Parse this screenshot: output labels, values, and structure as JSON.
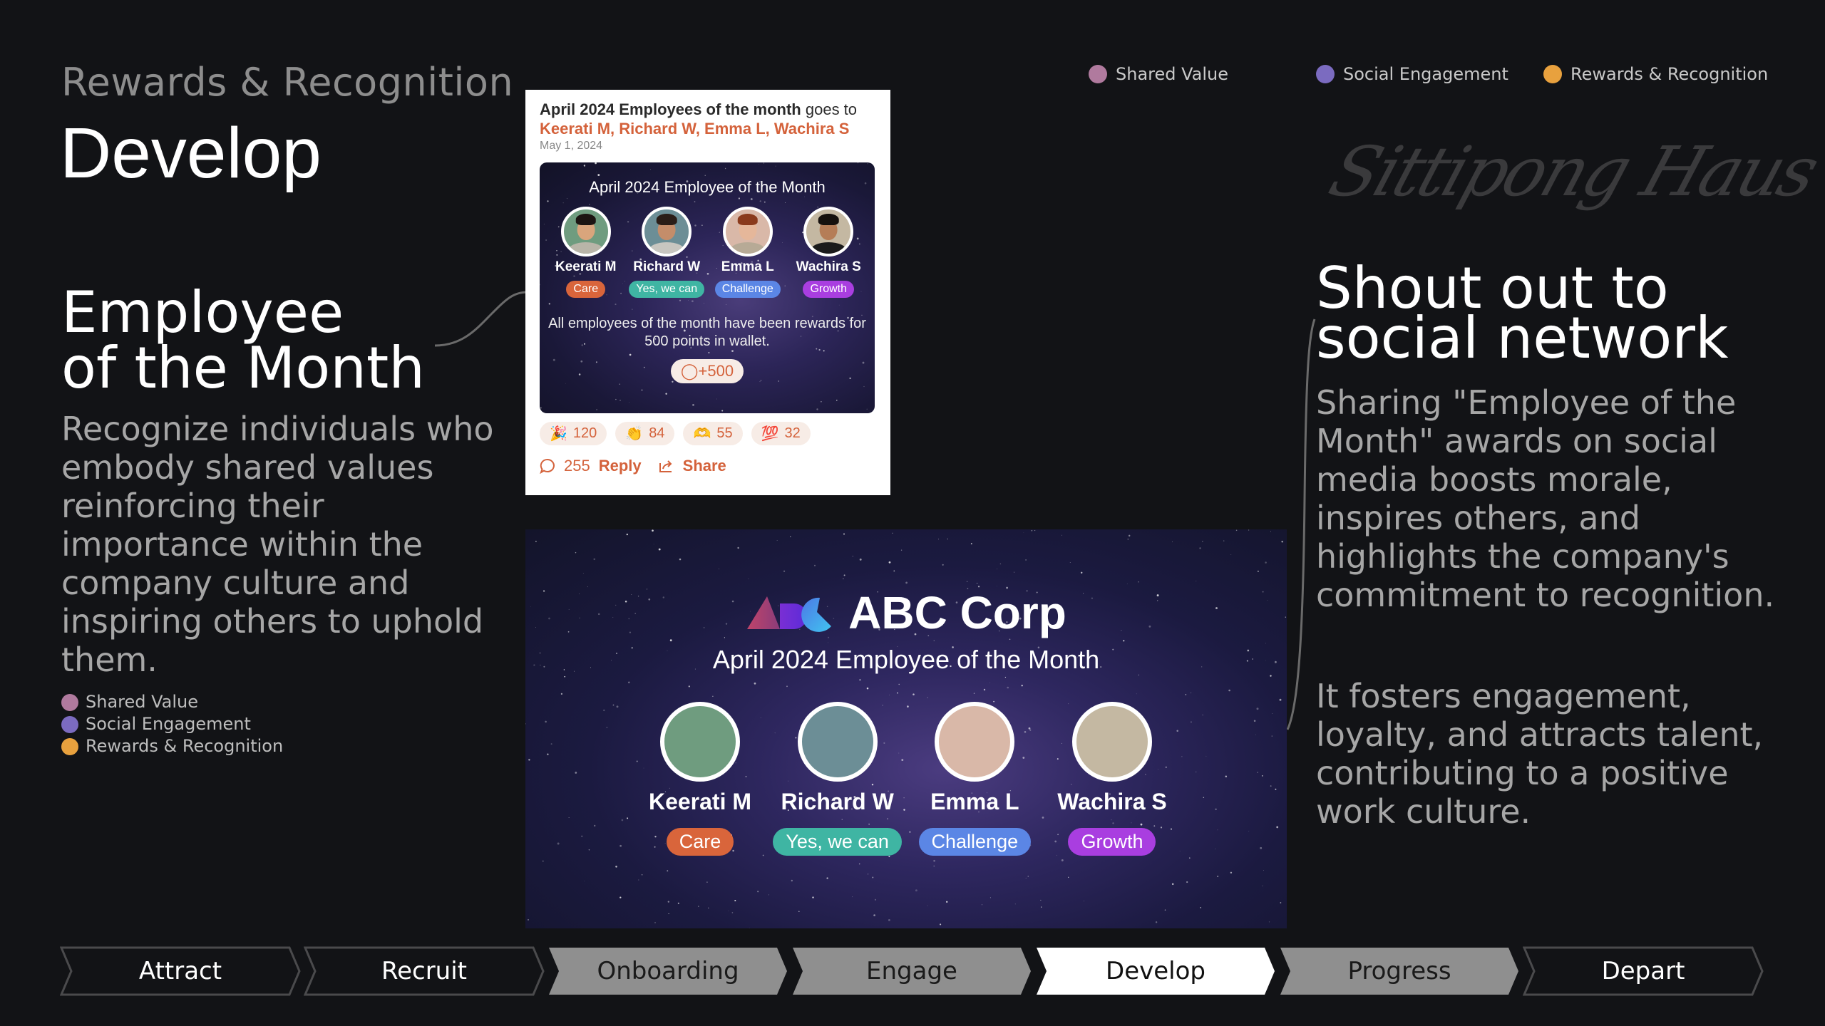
{
  "header": {
    "kicker": "Rewards & Recognition",
    "title": "Develop"
  },
  "legend": [
    {
      "label": "Shared Value",
      "color": "#b07a9e"
    },
    {
      "label": "Social Engagement",
      "color": "#7b6bc0"
    },
    {
      "label": "Rewards & Recognition",
      "color": "#e8a13e"
    }
  ],
  "signature": "Sittipong Haus",
  "left_section": {
    "title_line1": "Employee",
    "title_line2": "of the Month",
    "description": "Recognize individuals who embody shared values reinforcing their importance within the company culture and inspiring others to uphold them."
  },
  "post": {
    "headline_bold": "April 2024 Employees of the month",
    "headline_rest": " goes to",
    "names": "Keerati M, Richard W, Emma L, Wachira S",
    "date": "May 1, 2024",
    "media_title": "April 2024 Employee of the Month",
    "message": "All employees of the month have been rewards for 500 points in wallet.",
    "points": "+500",
    "points_icon": "coin-icon",
    "reactions": [
      {
        "emoji": "🎉",
        "icon": "party-popper-icon",
        "count": "120"
      },
      {
        "emoji": "👏",
        "icon": "clapping-hands-icon",
        "count": "84"
      },
      {
        "emoji": "🫶",
        "icon": "heart-hands-icon",
        "count": "55"
      },
      {
        "emoji": "💯",
        "icon": "hundred-points-icon",
        "count": "32"
      }
    ],
    "comment_count": "255",
    "reply_label": "Reply",
    "share_label": "Share",
    "accent": "#d4623b"
  },
  "employees": [
    {
      "name": "Keerati M",
      "tag": "Care",
      "tag_color": "#d9653b",
      "bg": "#6f9c7f",
      "skin": "#d9a57c",
      "hair": "#1c1512",
      "shirt": "#b9b5a8"
    },
    {
      "name": "Richard W",
      "tag": "Yes, we can",
      "tag_color": "#3fb5a3",
      "bg": "#6c8e96",
      "skin": "#c48d6a",
      "hair": "#2a1d17",
      "shirt": "#c8c6c0"
    },
    {
      "name": "Emma L",
      "tag": "Challenge",
      "tag_color": "#5b86e5",
      "bg": "#d9b8a8",
      "skin": "#e5b79a",
      "hair": "#8a3a1c",
      "shirt": "#b7aa96"
    },
    {
      "name": "Wachira S",
      "tag": "Growth",
      "tag_color": "#a93ee0",
      "bg": "#c4b8a2",
      "skin": "#b57d57",
      "hair": "#16110e",
      "shirt": "#1b1b1b"
    }
  ],
  "big_card": {
    "brand": "ABC Corp",
    "title": "April 2024 Employee of the Month"
  },
  "right_section": {
    "title_line1": "Shout out to",
    "title_line2": "social network",
    "paragraph1": "Sharing \"Employee of the Month\" awards on social media boosts morale, inspires others, and highlights the company's commitment to recognition.",
    "paragraph2": "It fosters engagement, loyalty, and attracts talent, contributing to a positive work culture."
  },
  "stages": [
    {
      "label": "Attract",
      "state": "outline"
    },
    {
      "label": "Recruit",
      "state": "outline"
    },
    {
      "label": "Onboarding",
      "state": "muted"
    },
    {
      "label": "Engage",
      "state": "muted"
    },
    {
      "label": "Develop",
      "state": "active"
    },
    {
      "label": "Progress",
      "state": "muted"
    },
    {
      "label": "Depart",
      "state": "outline"
    }
  ]
}
